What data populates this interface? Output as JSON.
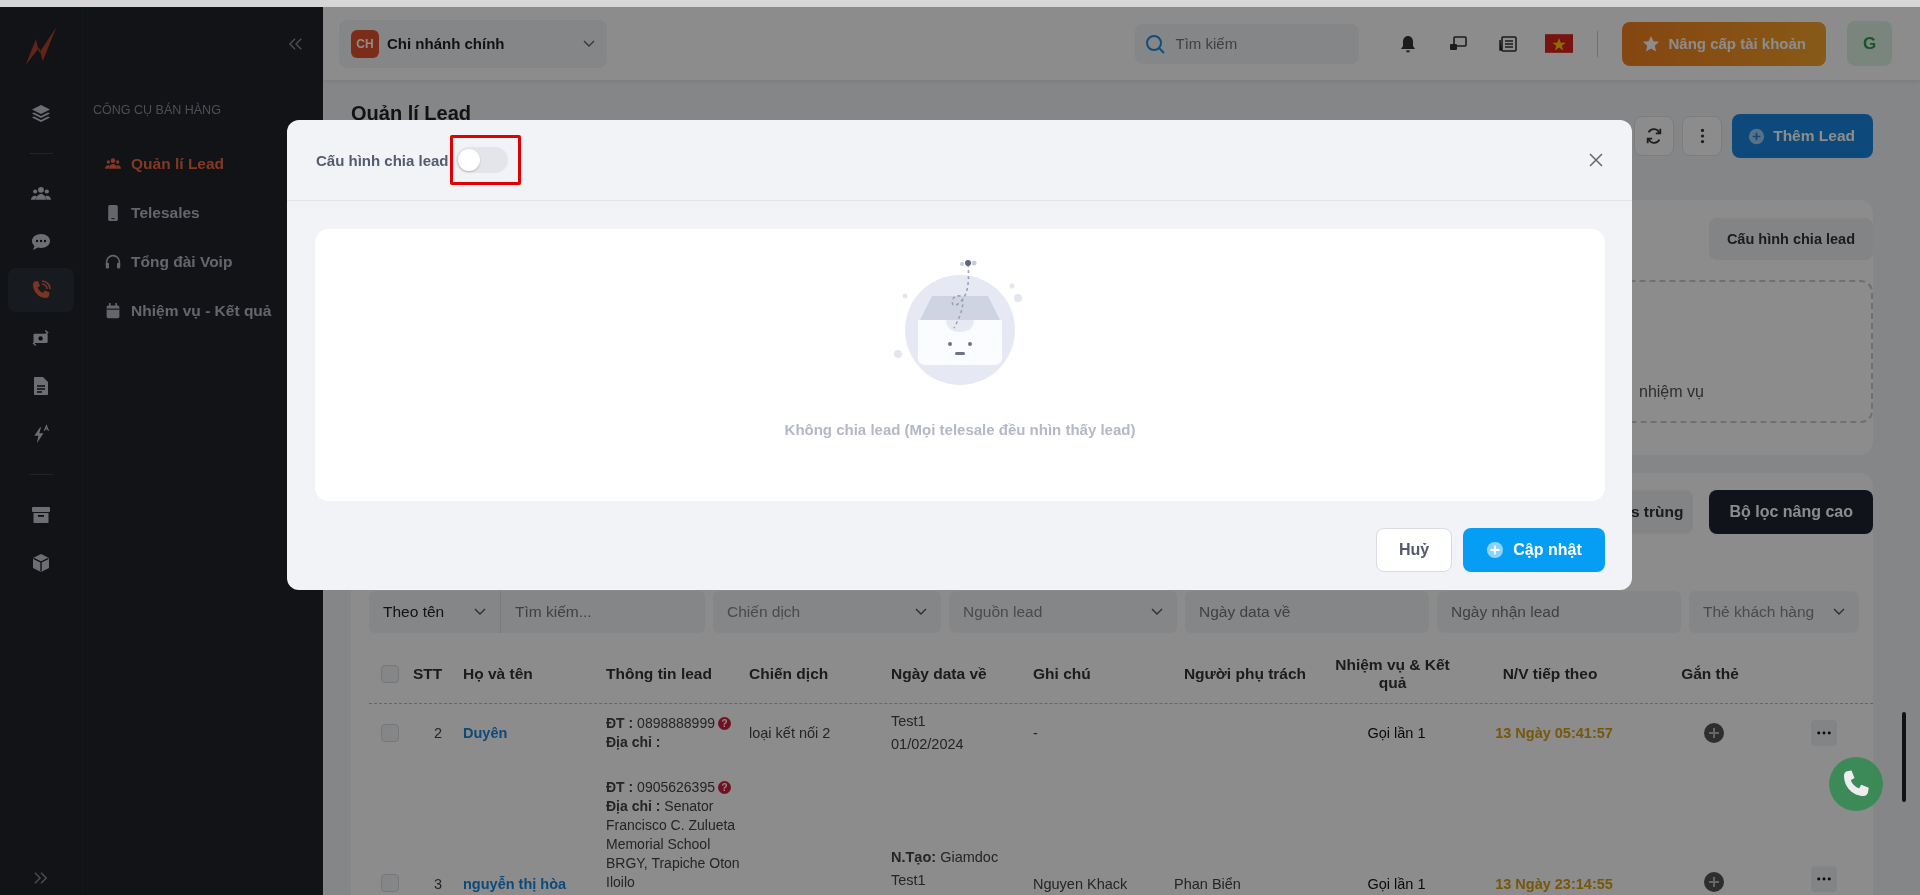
{
  "rail_groups": [
    [
      {
        "kind": "layers",
        "selected": false
      }
    ],
    [
      {
        "kind": "users",
        "selected": false
      },
      {
        "kind": "chat",
        "selected": false
      },
      {
        "kind": "phone",
        "selected": true
      },
      {
        "kind": "money",
        "selected": false
      },
      {
        "kind": "document",
        "selected": false
      },
      {
        "kind": "bolt",
        "selected": false
      }
    ],
    [
      {
        "kind": "archive",
        "selected": false
      },
      {
        "kind": "box",
        "selected": false
      }
    ]
  ],
  "menu": {
    "section_title": "CÔNG CỤ BÁN HÀNG",
    "items": [
      {
        "kind": "users",
        "label": "Quản lí Lead",
        "selected": true
      },
      {
        "kind": "mobile",
        "label": "Telesales",
        "selected": false
      },
      {
        "kind": "headset",
        "label": "Tổng đài Voip",
        "selected": false
      },
      {
        "kind": "calendar",
        "label": "Nhiệm vụ - Kết quả",
        "selected": false
      }
    ]
  },
  "topbar": {
    "branch_badge": "CH",
    "branch_name": "Chi nhánh chính",
    "search_placeholder": "Tìm kiếm",
    "upgrade_label": "Nâng cấp tài khoản",
    "avatar": "G"
  },
  "page": {
    "title": "Quản lí Lead",
    "add_label": "Thêm Lead",
    "config_label": "Cấu hình chia lead",
    "note_text": "nhiệm vụ",
    "duplicate_label": "s trùng",
    "advanced_filter_label": "Bộ lọc nâng cao"
  },
  "filters": [
    {
      "kind": "select",
      "label": "Theo tên"
    },
    {
      "kind": "input",
      "placeholder": "Tìm kiếm..."
    },
    {
      "kind": "select",
      "label": "Chiến dịch"
    },
    {
      "kind": "select",
      "label": "Nguồn lead"
    },
    {
      "kind": "date",
      "placeholder": "Ngày data về"
    },
    {
      "kind": "date",
      "placeholder": "Ngày nhận lead"
    },
    {
      "kind": "select",
      "label": "Thẻ khách hàng"
    }
  ],
  "table": {
    "all_checked": false,
    "columns": [
      "STT",
      "Họ và tên",
      "Thông tin lead",
      "Chiến dịch",
      "Ngày data về",
      "Ghi chú",
      "Người phụ trách",
      "Nhiệm vụ & Kết quả",
      "N/V tiếp theo",
      "Gắn thẻ"
    ],
    "rows": [
      {
        "checked": false,
        "stt": "2",
        "name": "Duyên",
        "phone": "**ĐT :** 0898888999",
        "warn_mark": "?",
        "address": "**Địa chỉ :**",
        "campaign": "loại kết nối 2",
        "date_lines": [
          "Test1",
          "01/02/2024"
        ],
        "note": "-",
        "task": "Gọi lần 1",
        "next_due": "13 Ngày 05:41:57"
      },
      {
        "checked": false,
        "stt": "3",
        "name": "nguyễn thị hòa",
        "phone": "**ĐT :** 0905626395",
        "warn_mark": "?",
        "address": "**Địa chỉ :** Senator Francisco C. Zulueta Memorial School BRGY, Trapiche Oton Iloilo",
        "date_lines": [
          "**N.Tạo:** Giamdoc",
          "Test1"
        ],
        "note": "Nguyen Khack",
        "owner": "Phan Biển",
        "task": "Gọi lần 1",
        "next_due": "13 Ngày 23:14:55"
      }
    ]
  },
  "modal": {
    "title": "Cấu hình chia lead",
    "enabled": false,
    "empty_text": "Không chia lead (Mọi telesale đều nhìn thấy lead)",
    "cancel_label": "Huỷ",
    "submit_label": "Cập nhật"
  }
}
